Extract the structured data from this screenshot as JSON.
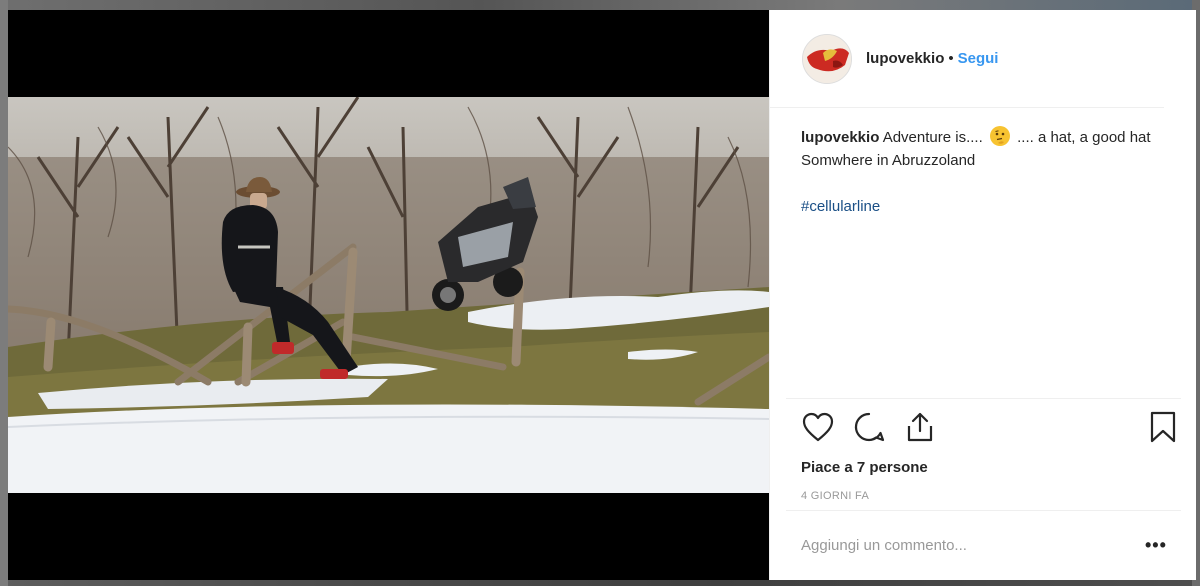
{
  "post": {
    "username": "lupovekkio",
    "separator": "•",
    "follow_label": "Segui",
    "caption": {
      "username": "lupovekkio",
      "text_before_emoji": "Adventure is....",
      "emoji": "thinking-face",
      "text_after_emoji": ".... a hat, a good hat",
      "line2": "Somwhere in Abruzzoland",
      "hashtag": "#cellularline"
    },
    "likes_text": "Piace a 7 persone",
    "time_text": "4 GIORNI FA",
    "comment_placeholder": "Aggiungi un commento...",
    "more_label": "•••"
  },
  "icons": {
    "like": "heart-icon",
    "comment": "comment-icon",
    "share": "share-icon",
    "save": "bookmark-icon"
  },
  "colors": {
    "link": "#3897f0",
    "hashtag": "#1a4f86",
    "text": "#262626",
    "muted": "#999999"
  }
}
